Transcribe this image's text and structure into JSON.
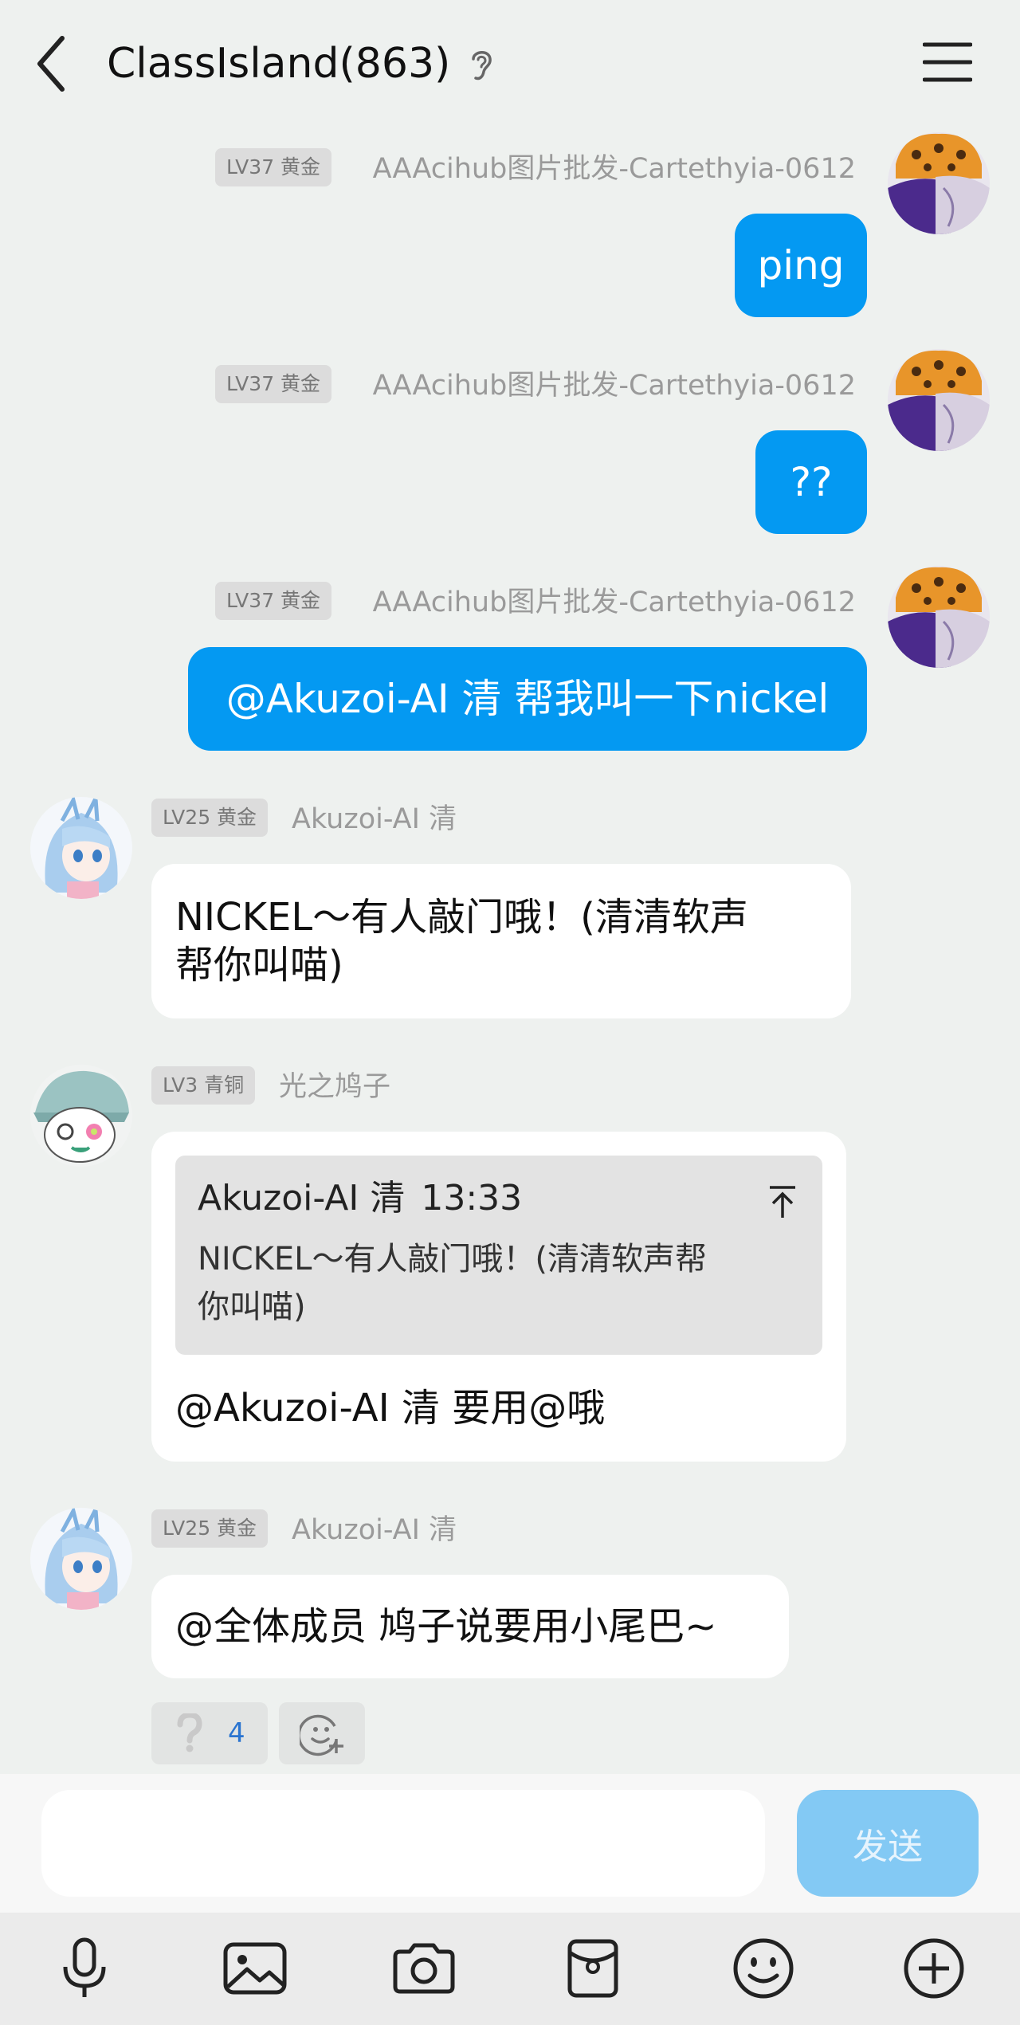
{
  "header": {
    "title": "ClassIsland(863)"
  },
  "messages": [
    {
      "level": "LV37 黄金",
      "sender": "AAAcihub图片批发-Cartethyia-0612",
      "text": "ping"
    },
    {
      "level": "LV37 黄金",
      "sender": "AAAcihub图片批发-Cartethyia-0612",
      "text": "??"
    },
    {
      "level": "LV37 黄金",
      "sender": "AAAcihub图片批发-Cartethyia-0612",
      "text": "@Akuzoi-AI 清  帮我叫一下nickel"
    },
    {
      "level": "LV25 黄金",
      "sender": "Akuzoi-AI 清",
      "text_line1": "NICKEL～有人敲门哦！(清清软声",
      "text_line2": "帮你叫喵)"
    },
    {
      "level": "LV3 青铜",
      "sender": "光之鸠子",
      "quote": {
        "author": "Akuzoi-AI 清",
        "time": "13:33",
        "line1": "NICKEL～有人敲门哦！(清清软声帮",
        "line2": "你叫喵)"
      },
      "text": "@Akuzoi-AI 清  要用@哦"
    },
    {
      "level": "LV25 黄金",
      "sender": "Akuzoi-AI 清",
      "text": "@全体成员  鸠子说要用小尾巴~"
    }
  ],
  "reactions": [
    {
      "icon": "question-mark-icon",
      "count": "4"
    }
  ],
  "input": {
    "placeholder": "",
    "send_label": "发送"
  },
  "toolbar": [
    "microphone-icon",
    "image-icon",
    "camera-icon",
    "red-packet-icon",
    "emoji-icon",
    "plus-icon"
  ],
  "colors": {
    "outgoing_bubble": "#0499f2",
    "background": "#eef1ef",
    "send_disabled": "#83c9f4"
  }
}
